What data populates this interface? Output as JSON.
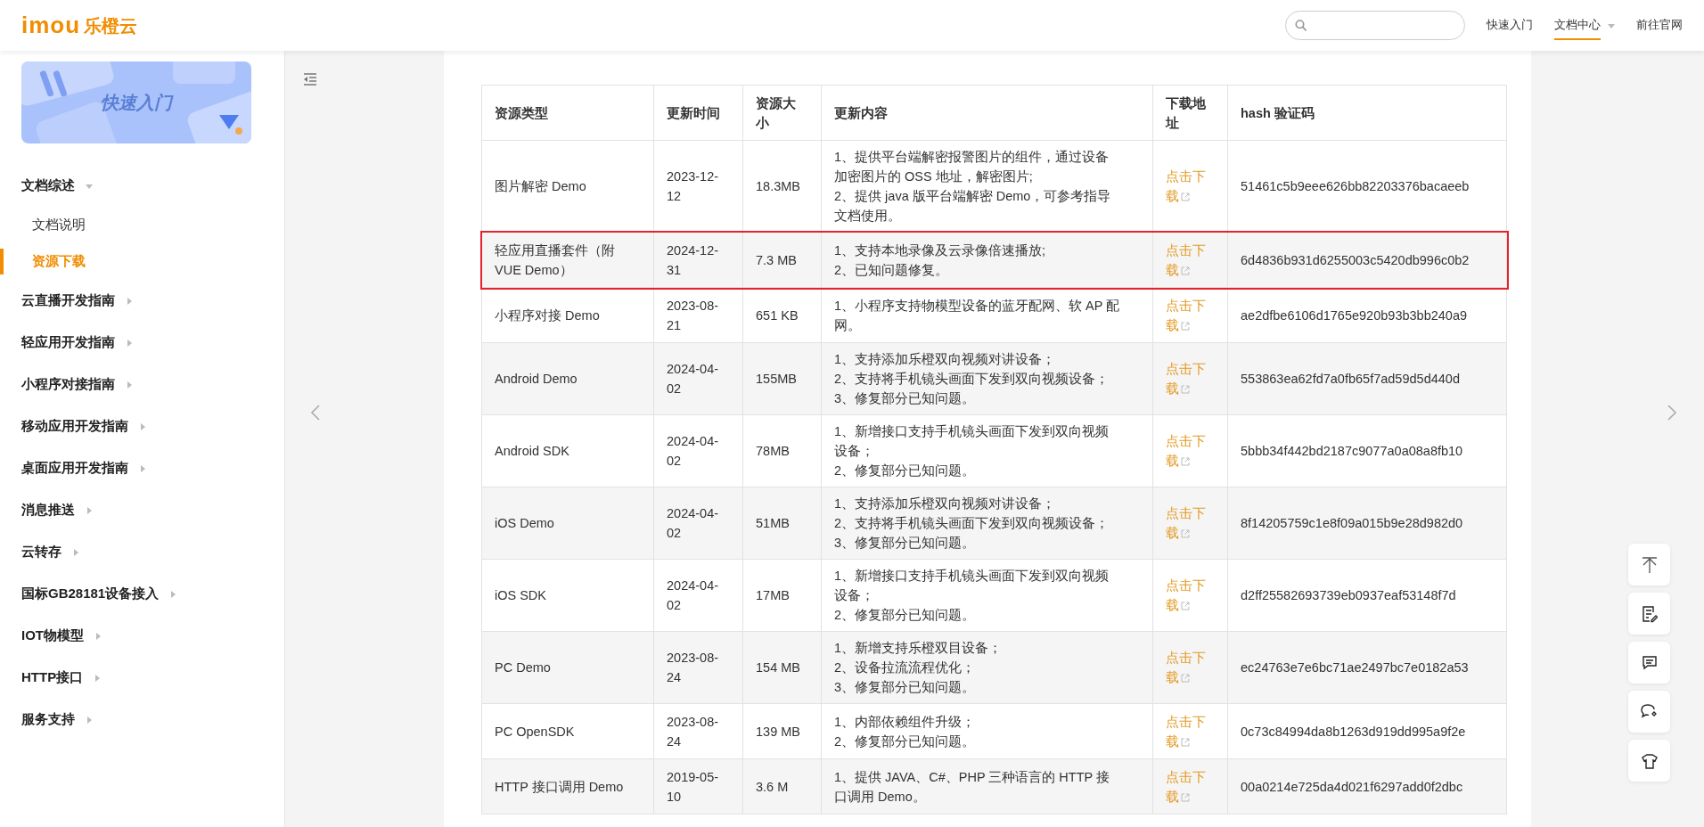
{
  "header": {
    "logo": "imou",
    "brand": "乐橙云",
    "nav": [
      {
        "label": "快速入门",
        "selected": false,
        "has_menu": false
      },
      {
        "label": "文档中心",
        "selected": true,
        "has_menu": true
      },
      {
        "label": "前往官网",
        "selected": false,
        "has_menu": false
      }
    ]
  },
  "sidebar": {
    "banner": {
      "title": "快速入门"
    },
    "items": [
      {
        "label": "文档综述",
        "expanded": true,
        "children": [
          {
            "label": "文档说明",
            "selected": false
          },
          {
            "label": "资源下载",
            "selected": true
          }
        ]
      },
      {
        "label": "云直播开发指南",
        "expanded": false
      },
      {
        "label": "轻应用开发指南",
        "expanded": false
      },
      {
        "label": "小程序对接指南",
        "expanded": false
      },
      {
        "label": "移动应用开发指南",
        "expanded": false
      },
      {
        "label": "桌面应用开发指南",
        "expanded": false
      },
      {
        "label": "消息推送",
        "expanded": false
      },
      {
        "label": "云转存",
        "expanded": false
      },
      {
        "label": "国标GB28181设备接入",
        "expanded": false
      },
      {
        "label": "IOT物模型",
        "expanded": false
      },
      {
        "label": "HTTP接口",
        "expanded": false
      },
      {
        "label": "服务支持",
        "expanded": false
      }
    ]
  },
  "table": {
    "columns": [
      "资源类型",
      "更新时间",
      "资源大小",
      "更新内容",
      "下载地址",
      "hash 验证码"
    ],
    "rows": [
      {
        "type": "图片解密 Demo",
        "date": "2023-12-12",
        "size": "18.3MB",
        "notes": [
          "1、提供平台端解密报警图片的组件，通过设备加密图片的 OSS 地址，解密图片;",
          "2、提供 java 版平台端解密 Demo，可参考指导文档使用。"
        ],
        "download": "点击下载",
        "hash": "51461c5b9eee626bb82203376bacaeeb",
        "highlighted": false
      },
      {
        "type": "轻应用直播套件（附 VUE Demo）",
        "date": "2024-12-31",
        "size": "7.3 MB",
        "notes": [
          "1、支持本地录像及云录像倍速播放;",
          "2、已知问题修复。"
        ],
        "download": "点击下载",
        "hash": "6d4836b931d6255003c5420db996c0b2",
        "highlighted": true
      },
      {
        "type": "小程序对接 Demo",
        "date": "2023-08-21",
        "size": "651 KB",
        "notes": [
          "1、小程序支持物模型设备的蓝牙配网、软 AP 配网。"
        ],
        "download": "点击下载",
        "hash": "ae2dfbe6106d1765e920b93b3bb240a9",
        "highlighted": false
      },
      {
        "type": "Android Demo",
        "date": "2024-04-02",
        "size": "155MB",
        "notes": [
          "1、支持添加乐橙双向视频对讲设备；",
          "2、支持将手机镜头画面下发到双向视频设备；",
          "3、修复部分已知问题。"
        ],
        "download": "点击下载",
        "hash": "553863ea62fd7a0fb65f7ad59d5d440d",
        "highlighted": false
      },
      {
        "type": "Android SDK",
        "date": "2024-04-02",
        "size": "78MB",
        "notes": [
          "1、新增接口支持手机镜头画面下发到双向视频设备；",
          "2、修复部分已知问题。"
        ],
        "download": "点击下载",
        "hash": "5bbb34f442bd2187c9077a0a08a8fb10",
        "highlighted": false
      },
      {
        "type": "iOS Demo",
        "date": "2024-04-02",
        "size": "51MB",
        "notes": [
          "1、支持添加乐橙双向视频对讲设备；",
          "2、支持将手机镜头画面下发到双向视频设备；",
          "3、修复部分已知问题。"
        ],
        "download": "点击下载",
        "hash": "8f14205759c1e8f09a015b9e28d982d0",
        "highlighted": false
      },
      {
        "type": "iOS SDK",
        "date": "2024-04-02",
        "size": "17MB",
        "notes": [
          "1、新增接口支持手机镜头画面下发到双向视频设备；",
          "2、修复部分已知问题。"
        ],
        "download": "点击下载",
        "hash": "d2ff25582693739eb0937eaf53148f7d",
        "highlighted": false
      },
      {
        "type": "PC Demo",
        "date": "2023-08-24",
        "size": "154 MB",
        "notes": [
          "1、新增支持乐橙双目设备；",
          "2、设备拉流流程优化；",
          "3、修复部分已知问题。"
        ],
        "download": "点击下载",
        "hash": "ec24763e7e6bc71ae2497bc7e0182a53",
        "highlighted": false
      },
      {
        "type": "PC OpenSDK",
        "date": "2023-08-24",
        "size": "139 MB",
        "notes": [
          "1、内部依赖组件升级；",
          "2、修复部分已知问题。"
        ],
        "download": "点击下载",
        "hash": "0c73c84994da8b1263d919dd995a9f2e",
        "highlighted": false
      },
      {
        "type": "HTTP 接口调用 Demo",
        "date": "2019-05-10",
        "size": "3.6 M",
        "notes": [
          "1、提供 JAVA、C#、PHP 三种语言的 HTTP 接口调用 Demo。"
        ],
        "download": "点击下载",
        "hash": "00a0214e725da4d021f6297add0f2dbc",
        "highlighted": false
      }
    ]
  }
}
